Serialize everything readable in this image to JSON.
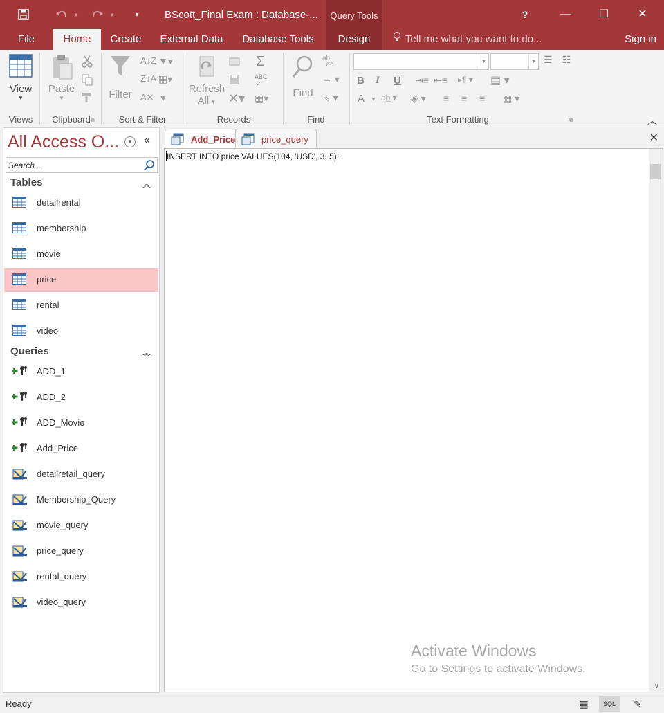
{
  "window": {
    "title": "BScott_Final Exam : Database-...",
    "contextual_tab": "Query Tools",
    "help_glyph": "?",
    "minimize_glyph": "—",
    "maximize_glyph": "☐",
    "close_glyph": "✕"
  },
  "ribbon_tabs": [
    "File",
    "Home",
    "Create",
    "External Data",
    "Database Tools",
    "Design"
  ],
  "tell_me": "Tell me what you want to do...",
  "sign_in": "Sign in",
  "ribbon": {
    "views": {
      "view_label": "View",
      "group": "Views"
    },
    "clipboard": {
      "paste_label": "Paste",
      "group": "Clipboard"
    },
    "sort_filter": {
      "filter_label": "Filter",
      "group": "Sort & Filter"
    },
    "records": {
      "refresh_label": "Refresh",
      "refresh_all": "All",
      "group": "Records"
    },
    "find": {
      "find_label": "Find",
      "group": "Find"
    },
    "text_formatting": {
      "group": "Text Formatting",
      "bold": "B",
      "italic": "I",
      "underline": "U",
      "font_color": "A"
    }
  },
  "nav": {
    "title": "All Access O...",
    "search_placeholder": "Search...",
    "tables_header": "Tables",
    "tables": [
      "detailrental",
      "membership",
      "movie",
      "price",
      "rental",
      "video"
    ],
    "queries_header": "Queries",
    "action_queries": [
      "ADD_1",
      "ADD_2",
      "ADD_Movie",
      "Add_Price"
    ],
    "select_queries": [
      "detailretail_query",
      "Membership_Query",
      "movie_query",
      "price_query",
      "rental_query",
      "video_query"
    ]
  },
  "document": {
    "tabs": [
      "Add_Price",
      "price_query"
    ],
    "close_glyph": "✕",
    "sql_text": "INSERT INTO price VALUES(104, 'USD', 3, 5);"
  },
  "watermark": {
    "line1": "Activate Windows",
    "line2": "Go to Settings to activate Windows."
  },
  "status": {
    "text": "Ready",
    "sql_view_label": "SQL"
  },
  "colors": {
    "accent": "#a4373a",
    "selected_item": "#f9c5c6"
  }
}
